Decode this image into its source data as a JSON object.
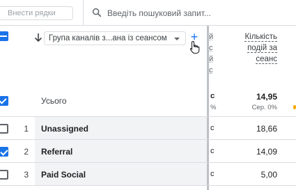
{
  "toolbar": {
    "rows_placeholder": "Внести рядки",
    "search_placeholder": "Введіть пошуковий запит..."
  },
  "header": {
    "dimension_label": "Група каналів з...ана із сеансом",
    "add_dimension_label": "+",
    "partial_metric_header_lines": [
      "й",
      "с",
      "й",
      "с"
    ],
    "metric_header_lines": [
      "Кількість",
      "подій за",
      "сеанс"
    ]
  },
  "total": {
    "label": "Усього",
    "partial_value": "с",
    "partial_sub": "%",
    "value": "14,95",
    "sub": "Сер. 0%"
  },
  "rows": [
    {
      "index": "1",
      "label": "Unassigned",
      "partial": "с",
      "value": "18,66",
      "checked": false
    },
    {
      "index": "2",
      "label": "Referral",
      "partial": "с",
      "value": "14,09",
      "checked": true
    },
    {
      "index": "3",
      "label": "Paid Social",
      "partial": "с",
      "value": "5,00",
      "checked": false
    }
  ],
  "colors": {
    "accent": "#1a73e8",
    "highlight_cell": "#f1f3f4",
    "orange_mark": "#f9ab00"
  }
}
